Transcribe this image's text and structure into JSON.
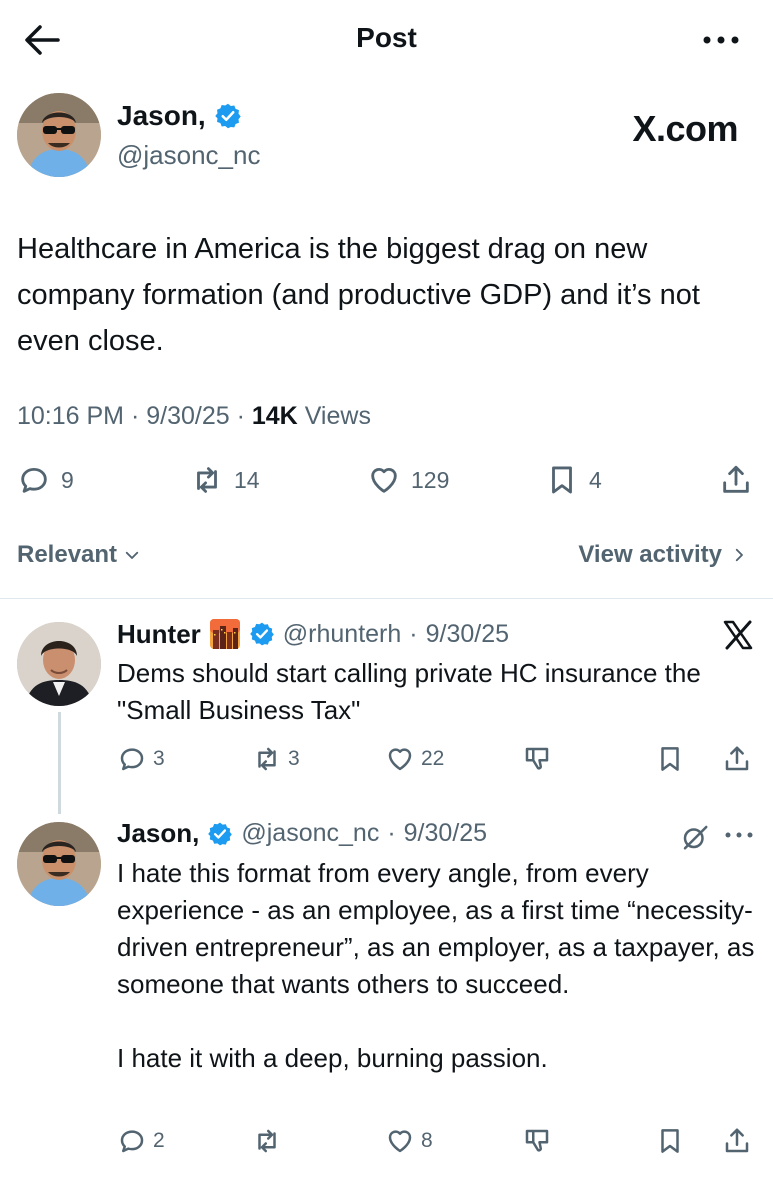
{
  "header": {
    "title": "Post"
  },
  "main_post": {
    "author_name": "Jason,",
    "handle": "@jasonc_nc",
    "watermark": "X.com",
    "text": "Healthcare in America is the biggest drag on new company formation (and productive GDP) and it’s not even close.",
    "time": "10:16 PM",
    "date": "9/30/25",
    "views_count": "14K",
    "views_label": "Views",
    "replies": "9",
    "reposts": "14",
    "likes": "129",
    "bookmarks": "4"
  },
  "filters": {
    "relevant_label": "Relevant",
    "view_activity_label": "View activity"
  },
  "replies": [
    {
      "name": "Hunter",
      "handle": "@rhunterh",
      "date": "9/30/25",
      "text": "Dems should start calling private HC insurance the \"Small Business Tax\"",
      "replies": "3",
      "reposts": "3",
      "likes": "22"
    },
    {
      "name": "Jason,",
      "handle": "@jasonc_nc",
      "date": "9/30/25",
      "text": "I hate this format from every angle, from every experience - as an employee, as a first time “necessity-driven entrepreneur”, as an employer, as a taxpayer, as someone that wants others to succeed.\n\nI hate it with a deep, burning passion.",
      "replies": "2",
      "reposts": "",
      "likes": "8"
    }
  ],
  "colors": {
    "verified": "#1d9bf0",
    "secondary_text": "#536471",
    "primary_text": "#0f1419"
  }
}
